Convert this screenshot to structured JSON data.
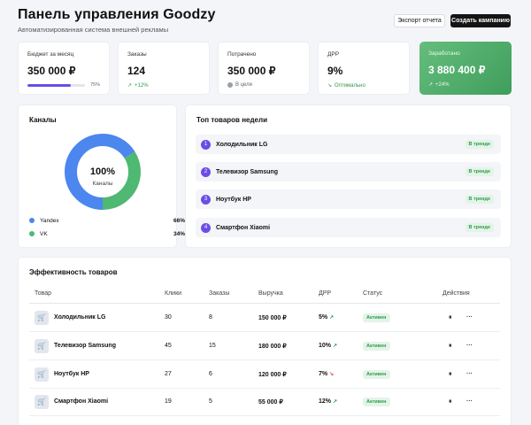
{
  "header": {
    "title": "Панель управления Goodzy",
    "subtitle": "Автоматизированная система внешней рекламы",
    "export_label": "Экспорт отчета",
    "create_label": "Создать кампанию"
  },
  "kpis": {
    "budget": {
      "label": "Бюджет за месяц",
      "value": "350 000 ₽",
      "progress_pct": "75%",
      "progress_value": 75
    },
    "orders": {
      "label": "Заказы",
      "value": "124",
      "sub": "+12%"
    },
    "spent": {
      "label": "Потрачено",
      "value": "350 000 ₽",
      "sub": "В цели"
    },
    "drr": {
      "label": "ДРР",
      "value": "9%",
      "sub": "Оптимально"
    },
    "earned": {
      "label": "Заработано",
      "value": "3 880 400 ₽",
      "sub": "+24%"
    }
  },
  "channels": {
    "title": "Каналы",
    "center_value": "100%",
    "center_label": "Каналы",
    "items": [
      {
        "name": "Yandex",
        "value": "66%",
        "share": 66,
        "color": "#4c86ef"
      },
      {
        "name": "VK",
        "value": "34%",
        "share": 34,
        "color": "#4fb872"
      }
    ]
  },
  "top_products": {
    "title": "Топ товаров недели",
    "items": [
      {
        "rank": "1",
        "name": "Холодильник LG",
        "badge": "В тренде"
      },
      {
        "rank": "2",
        "name": "Телевизор Samsung",
        "badge": "В тренде"
      },
      {
        "rank": "3",
        "name": "Ноутбук HP",
        "badge": "В тренде"
      },
      {
        "rank": "4",
        "name": "Смартфон Xiaomi",
        "badge": "В тренде"
      }
    ]
  },
  "efficiency": {
    "title": "Эффективность товаров",
    "columns": [
      "Товар",
      "Клики",
      "Заказы",
      "Выручка",
      "ДРР",
      "Статус",
      "Действия"
    ],
    "rows": [
      {
        "product": "Холодильник LG",
        "clicks": "30",
        "orders": "8",
        "revenue": "150 000 ₽",
        "drr": "5%",
        "trend": "up",
        "status": "Активен"
      },
      {
        "product": "Телевизор Samsung",
        "clicks": "45",
        "orders": "15",
        "revenue": "180 000 ₽",
        "drr": "10%",
        "trend": "up",
        "status": "Активен"
      },
      {
        "product": "Ноутбук HP",
        "clicks": "27",
        "orders": "6",
        "revenue": "120 000 ₽",
        "drr": "7%",
        "trend": "down",
        "status": "Активен"
      },
      {
        "product": "Смартфон Xiaomi",
        "clicks": "19",
        "orders": "5",
        "revenue": "55 000 ₽",
        "drr": "12%",
        "trend": "up",
        "status": "Активен"
      }
    ]
  },
  "colors": {
    "accent": "#6b4de6",
    "green": "#2f9a4a",
    "red": "#e05050"
  }
}
